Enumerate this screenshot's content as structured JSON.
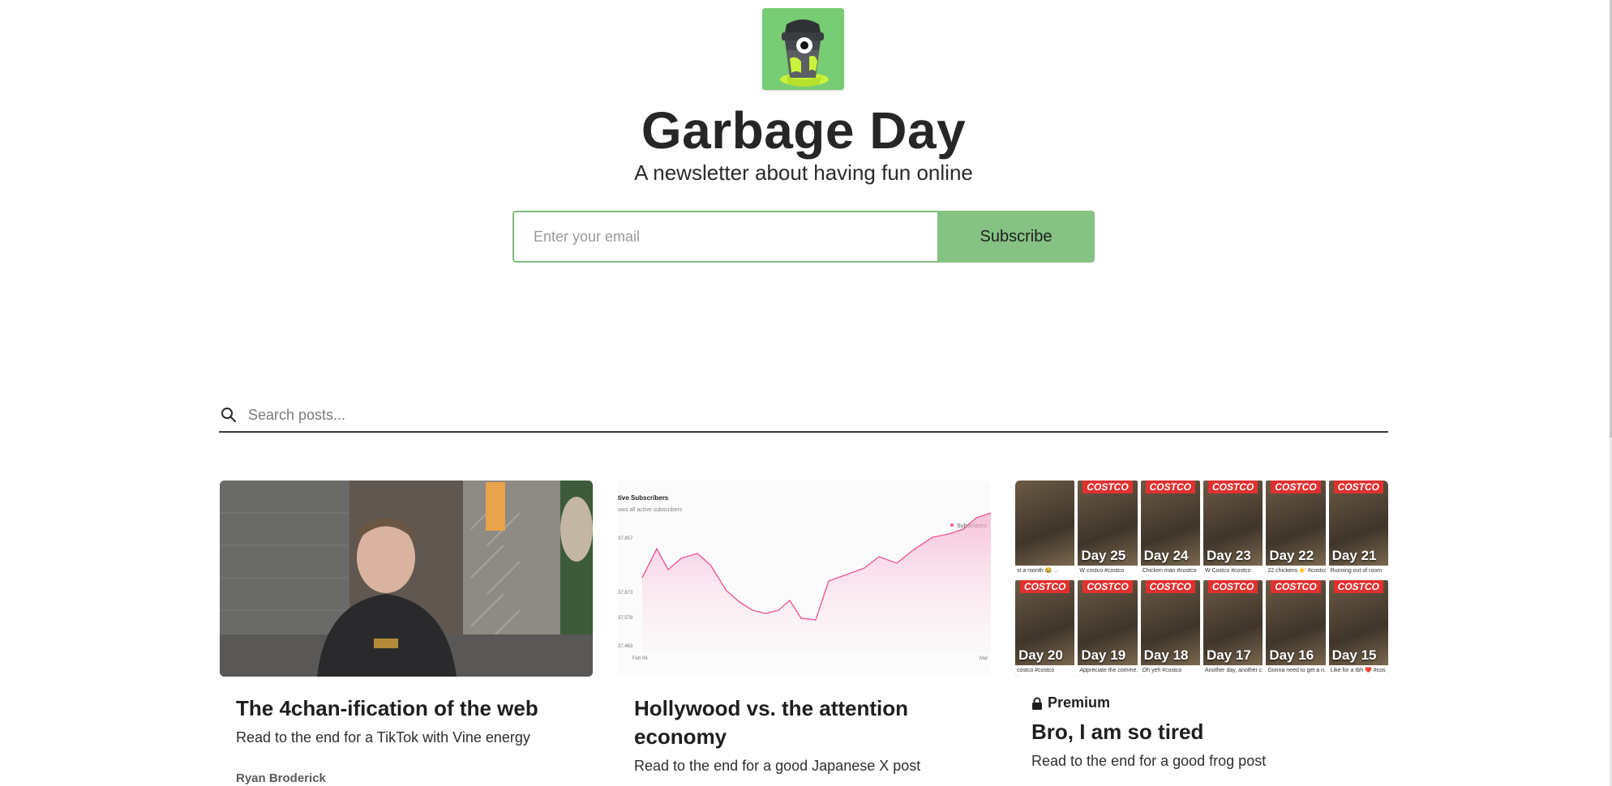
{
  "brand": {
    "title": "Garbage Day",
    "tagline": "A newsletter about having fun online"
  },
  "subscribe": {
    "email_placeholder": "Enter your email",
    "button_label": "Subscribe"
  },
  "search": {
    "placeholder": "Search posts..."
  },
  "posts": [
    {
      "title": "The 4chan-ification of the web",
      "subtitle": "Read to the end for a TikTok with Vine energy",
      "author": "Ryan Broderick"
    },
    {
      "title": "Hollywood vs. the attention economy",
      "subtitle": "Read to the end for a good Japanese X post"
    },
    {
      "badge": "Premium",
      "title": "Bro, I am so tired",
      "subtitle": "Read to the end for a good frog post"
    }
  ],
  "chart_thumb": {
    "title": "tive Subscribers",
    "subtitle": "ows all active subscribers",
    "legend": "Subscribers",
    "y_ticks": [
      "37,857",
      "37,673",
      "37,578",
      "37,463"
    ],
    "x_ticks": [
      "Feb 06",
      "Mar"
    ]
  },
  "costco_tiles": [
    {
      "day": "",
      "banner": "",
      "caption": "st a month 😂 ..."
    },
    {
      "day": "Day 25",
      "banner": "COSTCO",
      "caption": "W costco #costco"
    },
    {
      "day": "Day 24",
      "banner": "COSTCO",
      "caption": "Chicken man #costco"
    },
    {
      "day": "Day 23",
      "banner": "COSTCO",
      "caption": "W Costco #costco"
    },
    {
      "day": "Day 22",
      "banner": "COSTCO",
      "caption": "22 chickens 👉 #costco"
    },
    {
      "day": "Day 21",
      "banner": "COSTCO",
      "caption": "Running out of room"
    },
    {
      "day": "Day 20",
      "banner": "COSTCO",
      "caption": "costco #costco"
    },
    {
      "day": "Day 19",
      "banner": "COSTCO",
      "caption": "Appreciate the comme..."
    },
    {
      "day": "Day 18",
      "banner": "COSTCO",
      "caption": "Oh yeh #costco"
    },
    {
      "day": "Day 17",
      "banner": "COSTCO",
      "caption": "Another day, another c..."
    },
    {
      "day": "Day 16",
      "banner": "COSTCO",
      "caption": "Gonna need to get a n..."
    },
    {
      "day": "Day 15",
      "banner": "COSTCO",
      "caption": "Like for a tbh ❤️ #cos"
    }
  ],
  "colors": {
    "accent_green": "#85c283",
    "input_border": "#7fbe7c",
    "chart_line": "#e85a9a"
  }
}
